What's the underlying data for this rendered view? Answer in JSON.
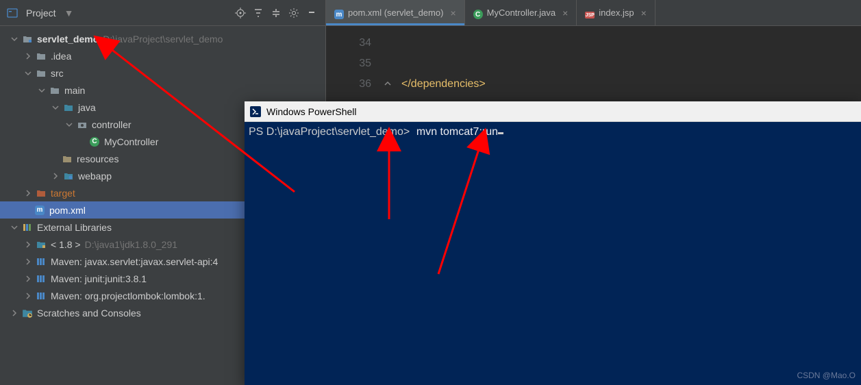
{
  "projectPanel": {
    "title": "Project",
    "tree": {
      "root": {
        "name": "servlet_demo",
        "path": "D:\\javaProject\\servlet_demo"
      },
      "idea": ".idea",
      "src": "src",
      "main": "main",
      "java": "java",
      "controller": "controller",
      "mycontroller": "MyController",
      "resources": "resources",
      "webapp": "webapp",
      "target": "target",
      "pom": "pom.xml",
      "ext": "External Libraries",
      "jdk": {
        "name": "< 1.8 >",
        "path": "D:\\java1\\jdk1.8.0_291"
      },
      "mvn1": "Maven: javax.servlet:javax.servlet-api:4",
      "mvn2": "Maven: junit:junit:3.8.1",
      "mvn3": "Maven: org.projectlombok:lombok:1.",
      "scratch": "Scratches and Consoles"
    }
  },
  "editor": {
    "tabs": {
      "pom": "pom.xml (servlet_demo)",
      "controller": "MyController.java",
      "index": "index.jsp"
    },
    "lines": {
      "l1": "34",
      "l2": "35",
      "l3": "36"
    },
    "code": {
      "line3": "</dependencies>"
    }
  },
  "powershell": {
    "title": "Windows PowerShell",
    "prompt": "PS D:\\javaProject\\servlet_demo>",
    "command": "mvn tomcat7:run",
    "watermark": "CSDN @Mao.O"
  }
}
